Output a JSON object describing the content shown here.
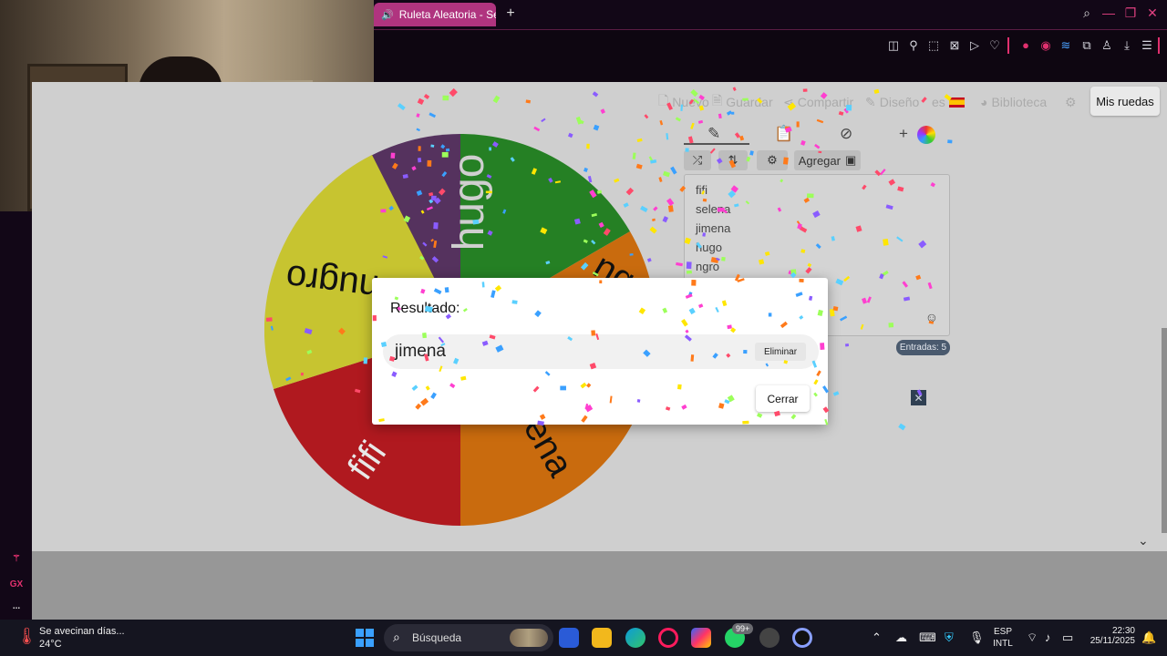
{
  "browser": {
    "tab_title": "Ruleta Aleatoria - Sele",
    "new_tab_label": "+"
  },
  "site": {
    "menu": {
      "nuevo": "Nuevo",
      "guardar": "Guardar",
      "compartir": "Compartir",
      "diseno": "Diseño",
      "language": "es",
      "biblioteca": "Biblioteca"
    },
    "mis_ruedas": "Mis ruedas",
    "agregar_label": "Agregar",
    "entries": [
      "fifi",
      "selena",
      "jimena",
      "hugo",
      "ngro"
    ],
    "entries_count_label": "Entradas: 5",
    "wheel": {
      "segments": [
        {
          "label": "hugo",
          "color": "#55325e"
        },
        {
          "label": "ngro",
          "color": "#258024"
        },
        {
          "label": "selena",
          "color": "#c96b0e"
        },
        {
          "label": "fifi",
          "color": "#b0191f"
        },
        {
          "label": "jimena",
          "color": "#c7c430"
        }
      ],
      "visible_labels": {
        "hugo": "hugo",
        "nugro": "nugro",
        "ena": "ena",
        "fifi": "fifi",
        "ng": "ng"
      }
    }
  },
  "modal": {
    "title": "Resultado:",
    "result": "jimena",
    "eliminar": "Eliminar",
    "cerrar": "Cerrar"
  },
  "sidebar": {
    "gx_label": "GX",
    "more_label": "..."
  },
  "taskbar": {
    "weather_text": "Se avecinan días...",
    "temperature": "24°C",
    "search_label": "Búsqueda",
    "notif_badge": "99+",
    "lang_line1": "ESP",
    "lang_line2": "INTL",
    "time": "22:30",
    "date": "25/11/2025"
  },
  "colors": {
    "accent": "#e0306e",
    "tab": "#b0347f",
    "modal_bg": "#ffffff"
  }
}
